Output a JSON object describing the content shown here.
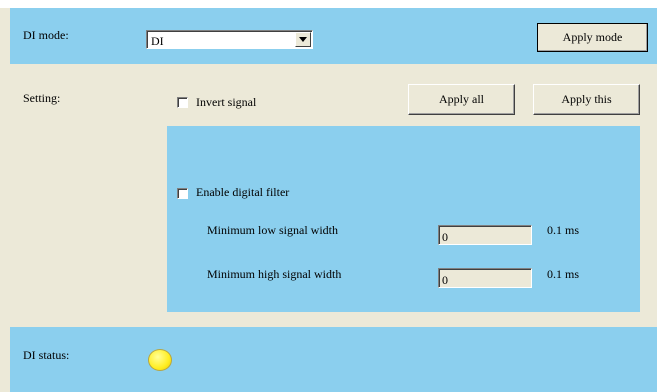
{
  "mode_row": {
    "label": "DI mode:",
    "select_value": "DI",
    "apply_mode_label": "Apply mode"
  },
  "setting": {
    "label": "Setting:",
    "invert_signal_label": "Invert signal",
    "invert_signal_checked": false,
    "apply_all_label": "Apply all",
    "apply_this_label": "Apply this"
  },
  "filter": {
    "enable_label": "Enable digital filter",
    "enable_checked": false,
    "min_low_label": "Minimum low signal width",
    "min_low_value": "0",
    "min_low_unit": "0.1 ms",
    "min_high_label": "Minimum high signal width",
    "min_high_value": "0",
    "min_high_unit": "0.1 ms"
  },
  "status": {
    "label": "DI status:",
    "led_color": "#ffee22"
  },
  "colors": {
    "band": "#8bcfee",
    "background": "#ece9d8"
  },
  "icons": {
    "dropdown": "chevron-down-icon",
    "status": "status-led-icon"
  }
}
